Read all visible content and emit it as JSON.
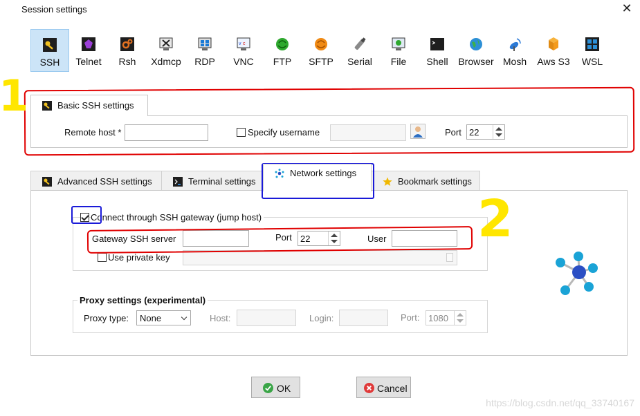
{
  "window": {
    "title": "Session settings"
  },
  "protocols": [
    {
      "label": "SSH",
      "icon": "ssh-icon",
      "selected": true
    },
    {
      "label": "Telnet",
      "icon": "telnet-icon"
    },
    {
      "label": "Rsh",
      "icon": "rsh-icon"
    },
    {
      "label": "Xdmcp",
      "icon": "xdmcp-icon"
    },
    {
      "label": "RDP",
      "icon": "rdp-icon"
    },
    {
      "label": "VNC",
      "icon": "vnc-icon"
    },
    {
      "label": "FTP",
      "icon": "ftp-icon"
    },
    {
      "label": "SFTP",
      "icon": "sftp-icon"
    },
    {
      "label": "Serial",
      "icon": "serial-icon"
    },
    {
      "label": "File",
      "icon": "file-icon"
    },
    {
      "label": "Shell",
      "icon": "shell-icon"
    },
    {
      "label": "Browser",
      "icon": "browser-icon"
    },
    {
      "label": "Mosh",
      "icon": "mosh-icon"
    },
    {
      "label": "Aws S3",
      "icon": "aws-s3-icon"
    },
    {
      "label": "WSL",
      "icon": "wsl-icon"
    }
  ],
  "basic": {
    "tab_label": "Basic SSH settings",
    "remote_host_label": "Remote host *",
    "remote_host_value": "",
    "specify_username_label": "Specify username",
    "specify_username_checked": false,
    "username_value": "",
    "port_label": "Port",
    "port_value": "22"
  },
  "tabs": [
    {
      "label": "Advanced SSH settings",
      "icon": "key-icon"
    },
    {
      "label": "Terminal settings",
      "icon": "terminal-icon"
    },
    {
      "label": "Network settings",
      "icon": "network-icon",
      "active": true
    },
    {
      "label": "Bookmark settings",
      "icon": "star-icon"
    }
  ],
  "network": {
    "gateway_checkbox_label": "Connect through SSH gateway (jump host)",
    "gateway_checked": true,
    "gateway_server_label": "Gateway SSH server",
    "gateway_server_value": "",
    "port_label": "Port",
    "port_value": "22",
    "user_label": "User",
    "user_value": "",
    "private_key_label": "Use private key",
    "private_key_checked": false,
    "private_key_value": ""
  },
  "proxy": {
    "group_title": "Proxy settings (experimental)",
    "type_label": "Proxy type:",
    "type_value": "None",
    "host_label": "Host:",
    "host_value": "",
    "login_label": "Login:",
    "login_value": "",
    "port_label": "Port:",
    "port_value": "1080"
  },
  "buttons": {
    "ok": "OK",
    "cancel": "Cancel"
  },
  "watermark": "https://blog.csdn.net/qq_33740167",
  "annotations": {
    "one": "1",
    "two": "2"
  },
  "colors": {
    "selection_bg": "#cce4f7",
    "annotation_red": "#e00000",
    "annotation_blue": "#1a1ad8",
    "annotation_yellow": "#ffe600",
    "network_blue": "#1aa3d6",
    "network_center": "#2b4fc4"
  }
}
